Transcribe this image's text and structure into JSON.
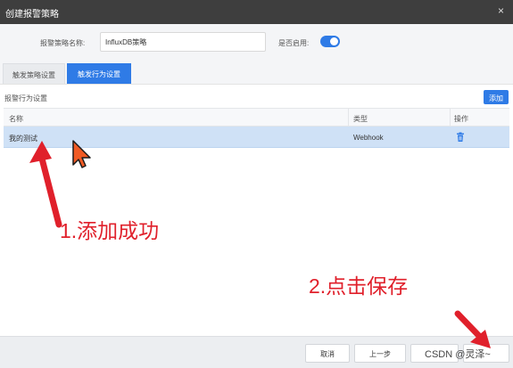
{
  "window": {
    "title": "创建报警策略",
    "close_glyph": "×"
  },
  "form": {
    "name_label": "报警策略名称:",
    "name_value": "InfluxDB策略",
    "enable_label": "是否启用:",
    "enabled": true
  },
  "tabs": [
    {
      "label": "触发策略设置",
      "active": false
    },
    {
      "label": "触发行为设置",
      "active": true
    }
  ],
  "panel": {
    "title": "报警行为设置",
    "add_label": "添加"
  },
  "table": {
    "columns": [
      "名称",
      "类型",
      "操作"
    ],
    "rows": [
      {
        "name": "我的测试",
        "type": "Webhook",
        "action_icon": "trash-icon"
      }
    ]
  },
  "annotations": {
    "step1": "1.添加成功",
    "step2": "2.点击保存"
  },
  "footer": {
    "cancel": "取消",
    "prev": "上一步",
    "next": "",
    "save": ""
  },
  "watermark": "CSDN @灵泽~",
  "colors": {
    "primary": "#2f7be6",
    "annotation": "#e0202b",
    "cursor": "#f05a24",
    "titlebar": "#3e3e3e",
    "selected_row": "#cfe1f6"
  }
}
